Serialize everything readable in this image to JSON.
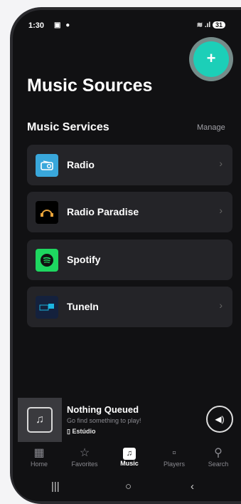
{
  "status": {
    "time": "1:30",
    "status_icons": "▣ ●",
    "signal": "≋ .ıl",
    "battery": "31"
  },
  "fab": {
    "label": "+"
  },
  "page": {
    "title": "Music Sources"
  },
  "section": {
    "title": "Music Services",
    "manage_label": "Manage"
  },
  "services": [
    {
      "label": "Radio",
      "icon": "radio-icon",
      "icon_bg": "#39a7db"
    },
    {
      "label": "Radio Paradise",
      "icon": "radio-paradise-icon",
      "icon_bg": "#000000"
    },
    {
      "label": "Spotify",
      "icon": "spotify-icon",
      "icon_bg": "#1ed760"
    },
    {
      "label": "TuneIn",
      "icon": "tunein-icon",
      "icon_bg": "#14213d"
    }
  ],
  "mini_player": {
    "title": "Nothing Queued",
    "subtitle": "Go find something to play!",
    "device": "Estúdio"
  },
  "tabs": [
    {
      "label": "Home",
      "icon": "home-icon"
    },
    {
      "label": "Favorites",
      "icon": "star-icon"
    },
    {
      "label": "Music",
      "icon": "music-icon",
      "active": true
    },
    {
      "label": "Players",
      "icon": "speaker-icon"
    },
    {
      "label": "Search",
      "icon": "search-icon"
    }
  ],
  "colors": {
    "accent": "#1ccfb8",
    "background": "#111113",
    "card": "#242428"
  }
}
